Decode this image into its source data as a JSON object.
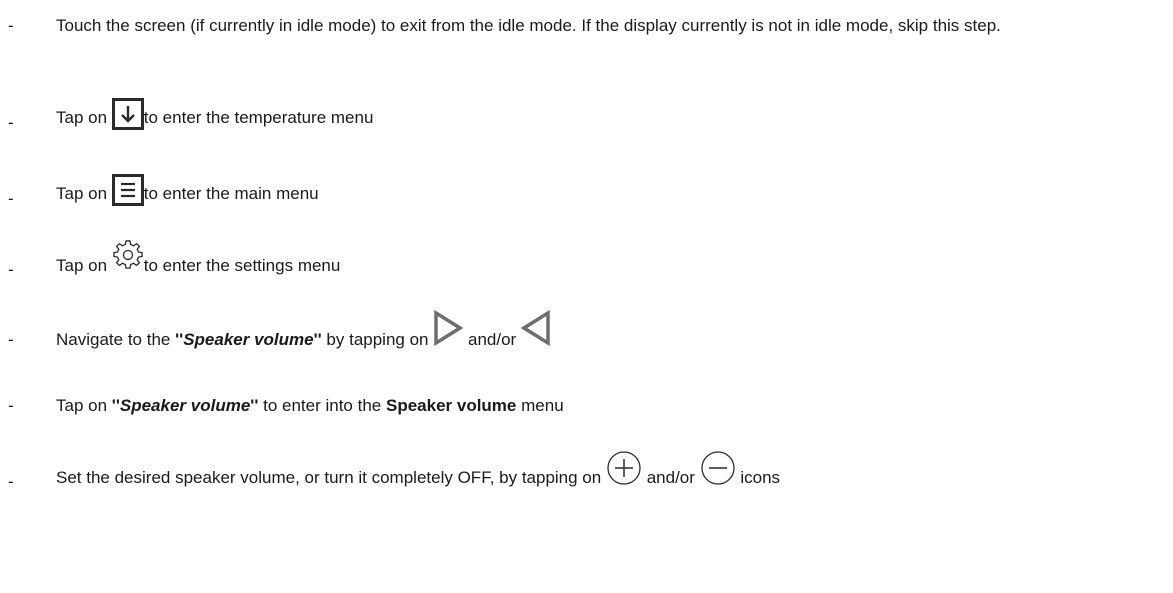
{
  "steps": [
    {
      "dash": "-",
      "text": "Touch the screen (if currently in idle mode) to exit from the idle mode. If the display currently is not in idle mode, skip this step."
    },
    {
      "dash": "-",
      "before": "Tap on",
      "icon": "down-arrow-box-icon",
      "after": "to enter the temperature menu"
    },
    {
      "dash": "-",
      "before": "Tap on",
      "icon": "menu-lines-box-icon",
      "after": "to enter the main menu"
    },
    {
      "dash": "-",
      "before": "Tap on",
      "icon": "gear-icon",
      "after": "to enter the settings menu"
    },
    {
      "dash": "-",
      "before": "Navigate to the",
      "quote_open": "''",
      "emph": "Speaker volume",
      "quote_close": "''",
      "middle": "by tapping on",
      "icon1": "triangle-right-icon",
      "and": "and/or",
      "icon2": "triangle-left-icon"
    },
    {
      "dash": "-",
      "before": "Tap on",
      "quote_open": "''",
      "emph": "Speaker volume",
      "quote_close": "''",
      "middle": "to enter into the",
      "bold": "Speaker volume",
      "after": "menu"
    },
    {
      "dash": "-",
      "before": "Set the desired speaker volume, or turn it completely OFF, by tapping on",
      "icon1": "plus-circle-icon",
      "and": "and/or",
      "icon2": "minus-circle-icon",
      "after": "icons"
    }
  ]
}
